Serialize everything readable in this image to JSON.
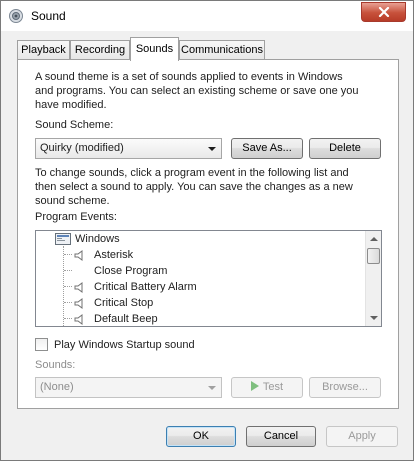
{
  "window": {
    "title": "Sound"
  },
  "tabs": [
    {
      "label": "Playback"
    },
    {
      "label": "Recording"
    },
    {
      "label": "Sounds",
      "active": true
    },
    {
      "label": "Communications"
    }
  ],
  "sounds": {
    "description": [
      "A sound theme is a set of sounds applied to events in Windows",
      "and programs.  You can select an existing scheme or save one you",
      "have modified."
    ],
    "scheme_label": "Sound Scheme:",
    "scheme_value": "Quirky (modified)",
    "save_as_label": "Save As...",
    "delete_label": "Delete",
    "instructions": [
      "To change sounds, click a program event in the following list and",
      "then select a sound to apply.  You can save the changes as a new",
      "sound scheme."
    ],
    "program_events_label": "Program Events:",
    "events": [
      {
        "label": "Windows",
        "level": 0,
        "icon": "windows-group-icon"
      },
      {
        "label": "Asterisk",
        "level": 1,
        "has_sound": true
      },
      {
        "label": "Close Program",
        "level": 1,
        "has_sound": false
      },
      {
        "label": "Critical Battery Alarm",
        "level": 1,
        "has_sound": true
      },
      {
        "label": "Critical Stop",
        "level": 1,
        "has_sound": true
      },
      {
        "label": "Default Beep",
        "level": 1,
        "has_sound": true
      }
    ],
    "startup_checkbox_label": "Play Windows Startup sound",
    "startup_checked": false,
    "sounds_label": "Sounds:",
    "sound_value": "(None)",
    "test_label": "Test",
    "browse_label": "Browse..."
  },
  "footer": {
    "ok_label": "OK",
    "cancel_label": "Cancel",
    "apply_label": "Apply"
  },
  "colors": {
    "dialog_bg": "#f0f0f0",
    "panel_bg": "#ffffff",
    "close_button": "#c7513b",
    "disabled_text": "#8d8d8d"
  }
}
